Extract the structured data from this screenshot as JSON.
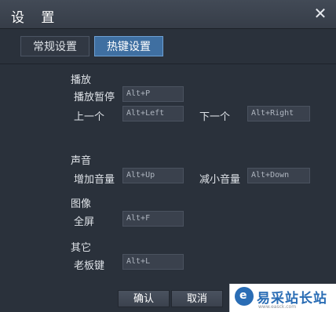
{
  "window": {
    "title": "设 置",
    "close_glyph": "✕"
  },
  "tabs": [
    {
      "label": "常规设置",
      "active": false
    },
    {
      "label": "热键设置",
      "active": true
    }
  ],
  "sections": {
    "playback": {
      "title": "播放",
      "items": [
        {
          "label": "播放暂停",
          "value": "Alt+P"
        },
        {
          "label": "上一个",
          "value": "Alt+Left"
        },
        {
          "label": "下一个",
          "value": "Alt+Right"
        }
      ]
    },
    "sound": {
      "title": "声音",
      "items": [
        {
          "label": "增加音量",
          "value": "Alt+Up"
        },
        {
          "label": "减小音量",
          "value": "Alt+Down"
        }
      ]
    },
    "image": {
      "title": "图像",
      "items": [
        {
          "label": "全屏",
          "value": "Alt+F"
        }
      ]
    },
    "other": {
      "title": "其它",
      "items": [
        {
          "label": "老板键",
          "value": "Alt+L"
        }
      ]
    }
  },
  "buttons": {
    "ok": "确认",
    "cancel": "取消"
  },
  "watermark": {
    "text": "易采站长站",
    "url": "www.easck.com",
    "logo_glyph": "e"
  },
  "colors": {
    "active_tab": "#3f6fa1",
    "background": "#2a313b",
    "brand": "#2a6db5"
  }
}
